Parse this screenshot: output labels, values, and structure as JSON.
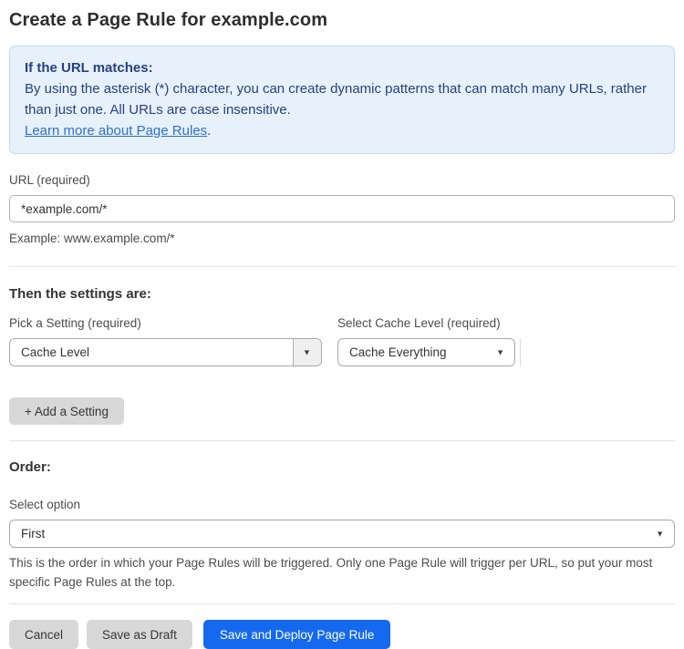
{
  "page": {
    "title": "Create a Page Rule for example.com"
  },
  "info_box": {
    "heading": "If the URL matches:",
    "body": "By using the asterisk (*) character, you can create dynamic patterns that can match many URLs, rather than just one. All URLs are case insensitive.",
    "link_label": "Learn more about Page Rules",
    "link_suffix": "."
  },
  "url_field": {
    "label": "URL (required)",
    "value": "*example.com/*",
    "example": "Example: www.example.com/*"
  },
  "settings_section": {
    "heading": "Then the settings are:",
    "setting_select": {
      "label": "Pick a Setting (required)",
      "value": "Cache Level"
    },
    "cache_level_select": {
      "label": "Select Cache Level (required)",
      "value": "Cache Everything"
    },
    "add_setting_label": "+ Add a Setting"
  },
  "order_section": {
    "heading": "Order:",
    "select_label": "Select option",
    "select_value": "First",
    "help_text": "This is the order in which your Page Rules will be triggered. Only one Page Rule will trigger per URL, so put your most specific Page Rules at the top."
  },
  "actions": {
    "cancel_label": "Cancel",
    "save_draft_label": "Save as Draft",
    "save_deploy_label": "Save and Deploy Page Rule"
  },
  "icons": {
    "dropdown_arrow": "▼"
  },
  "colors": {
    "accent_blue": "#1569ef",
    "info_background": "#e7f1fc",
    "info_border": "#bdd8f6",
    "info_text": "#27427e",
    "link_blue": "#2e6fd3",
    "button_gray": "#d8d8d8"
  }
}
